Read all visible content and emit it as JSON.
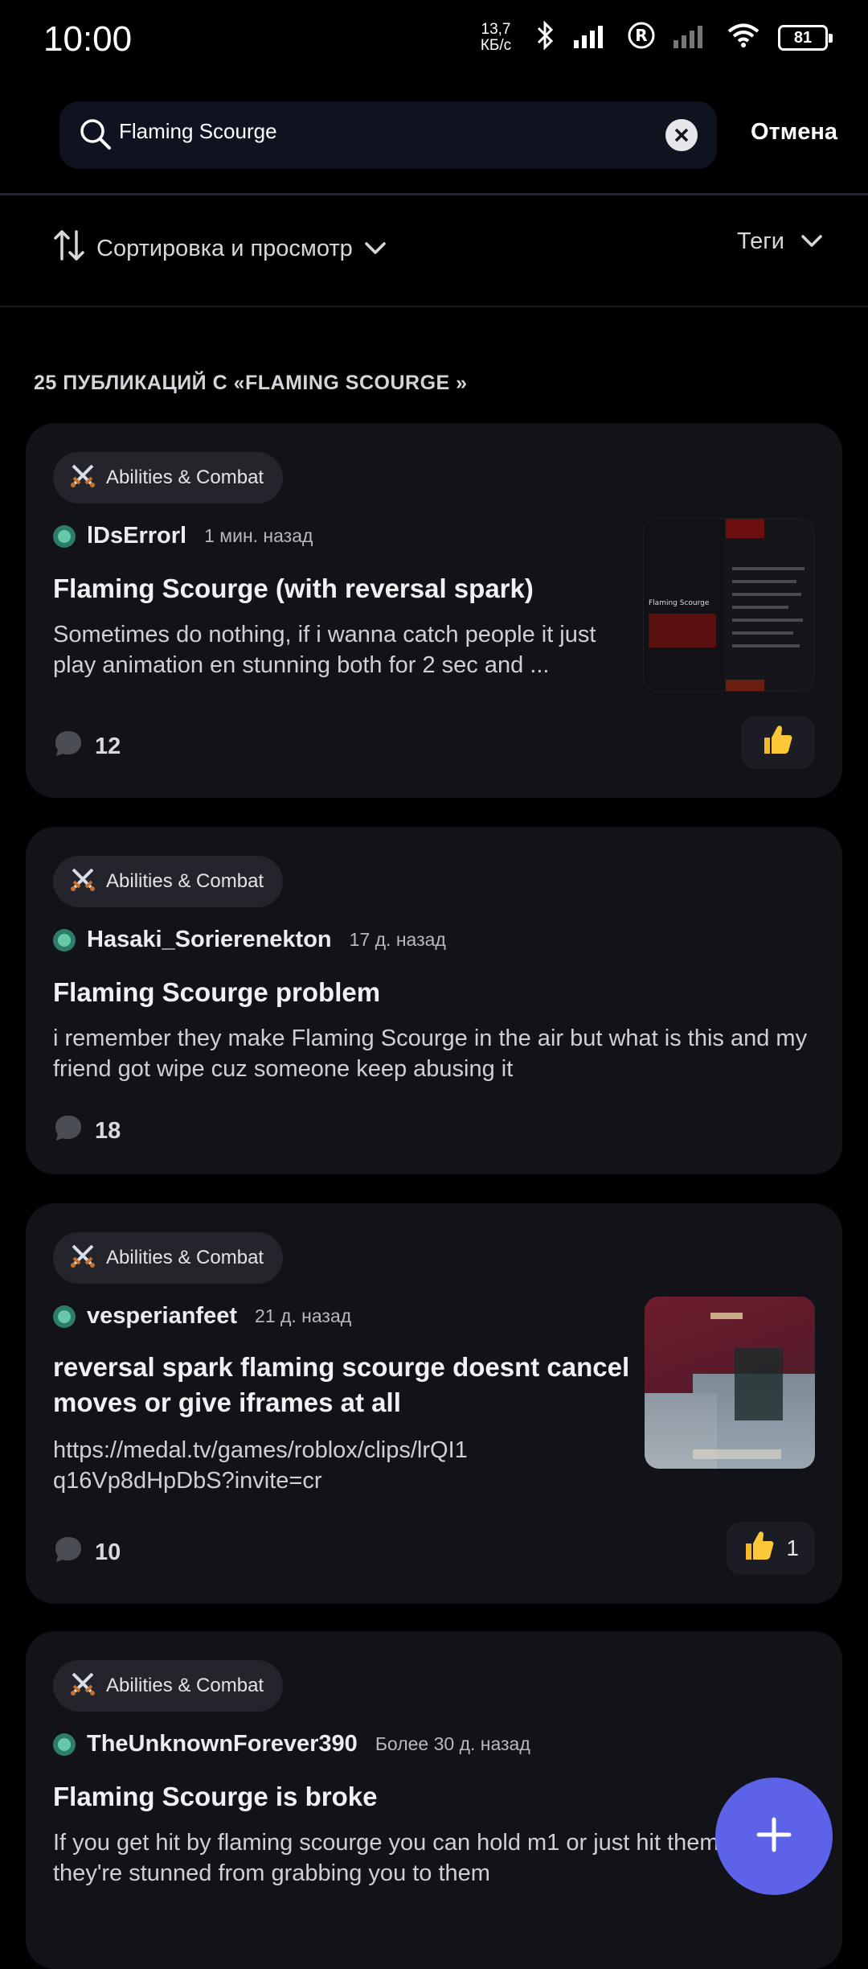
{
  "status": {
    "time": "10:00",
    "net_speed_value": "13,7",
    "net_speed_unit": "КБ/с",
    "battery": "81"
  },
  "search": {
    "query": "Flaming Scourge",
    "cancel_label": "Отмена"
  },
  "filters": {
    "sort_label": "Сортировка и просмотр",
    "tags_label": "Теги"
  },
  "results_count": "25 ПУБЛИКАЦИЙ С «FLAMING SCOURGE »",
  "posts": [
    {
      "tag": "Abilities & Combat",
      "author": "lDsErrorl",
      "time": "1 мин. назад",
      "title": "Flaming Scourge (with reversal spark)",
      "body": "Sometimes do nothing, if i wanna catch people it just play animation en stunning both for 2 sec and ...",
      "comments": "12",
      "likes": "",
      "thumb_caption": "Flaming Scourge"
    },
    {
      "tag": "Abilities & Combat",
      "author": "Hasaki_Sorierenekton",
      "time": "17 д. назад",
      "title": "Flaming Scourge problem",
      "body": "i remember they make Flaming Scourge in the air but what is this and my friend got wipe cuz someone keep abusing it",
      "comments": "18"
    },
    {
      "tag": "Abilities & Combat",
      "author": "vesperianfeet",
      "time": "21 д. назад",
      "title": "reversal spark flaming scourge doesnt cancel moves or give iframes at all",
      "body": "https://medal.tv/games/roblox/clips/lrQI1q16Vp8dHpDbS?invite=cr",
      "comments": "10",
      "likes": "1"
    },
    {
      "tag": "Abilities & Combat",
      "author": "TheUnknownForever390",
      "time": "Более 30 д. назад",
      "title": "Flaming Scourge is broke",
      "body": "If you get hit by flaming scourge you can hold m1 or just hit them they're stunned from grabbing you to them"
    }
  ],
  "colors": {
    "background": "#000000",
    "card": "#121319",
    "fab": "#5d63e8",
    "online_dot": "#66c8a7"
  }
}
